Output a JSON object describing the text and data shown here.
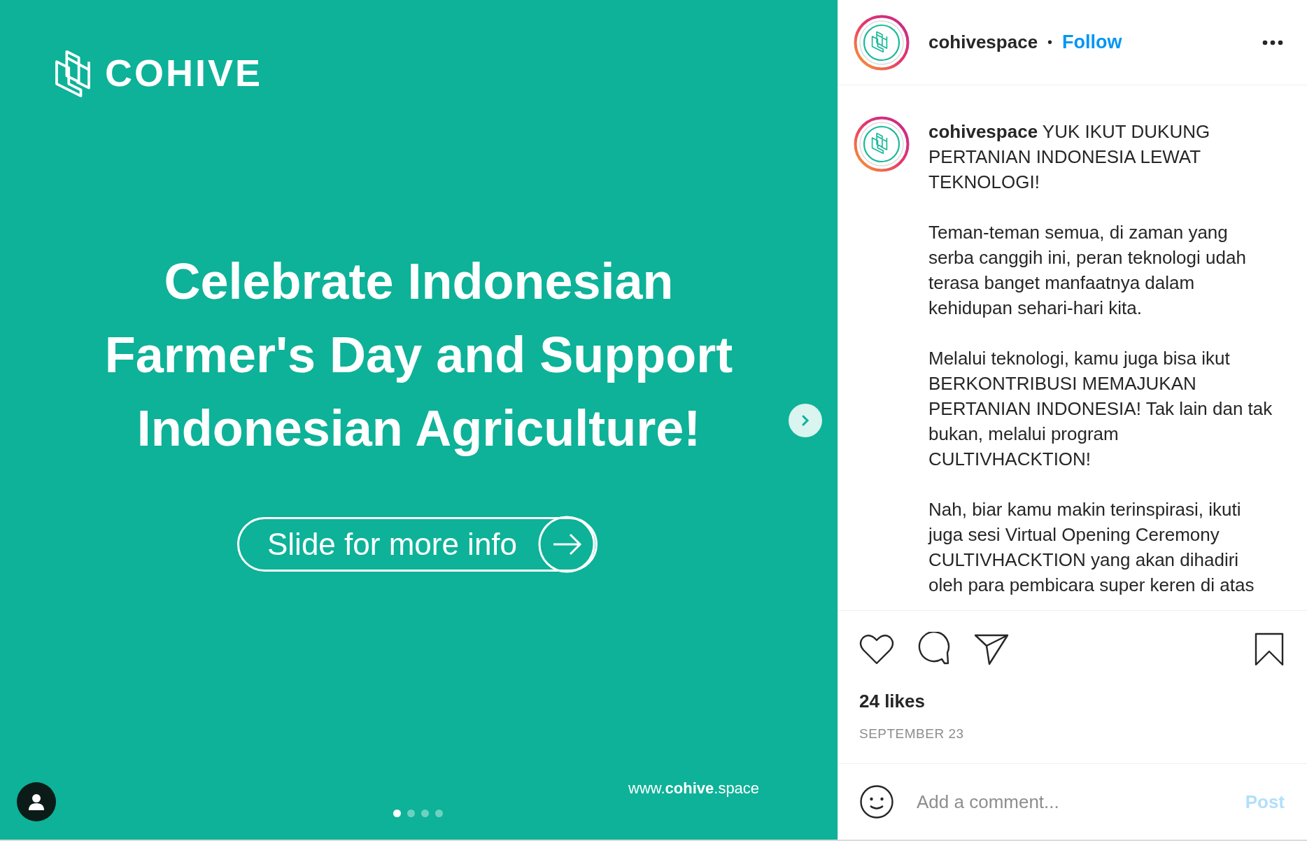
{
  "slide": {
    "brand": "COHIVE",
    "headline": "Celebrate Indonesian\nFarmer's Day and Support\nIndonesian Agriculture!",
    "cta": "Slide for more info",
    "website": "www.**cohive**.space",
    "dots": [
      {
        "selected": true
      },
      {
        "selected": false
      },
      {
        "selected": false
      },
      {
        "selected": false
      }
    ]
  },
  "header": {
    "username": "cohivespace",
    "separator": "•",
    "follow": "Follow"
  },
  "caption": {
    "username": "cohivespace",
    "paragraphs": [
      "YUK IKUT DUKUNG\nPERTANIAN INDONESIA LEWAT\nTEKNOLOGI!",
      "Teman-teman semua, di zaman yang\nserba canggih ini, peran teknologi udah\nterasa banget manfaatnya dalam\nkehidupan sehari-hari kita.",
      "Melalui teknologi, kamu juga bisa ikut\nBERKONTRIBUSI MEMAJUKAN\nPERTANIAN INDONESIA! Tak lain dan tak\nbukan, melalui program\nCULTIVHACKTION!",
      "Nah, biar kamu makin terinspirasi, ikuti\njuga sesi Virtual Opening Ceremony\nCULTIVHACKTION yang akan dihadiri\noleh para pembicara super keren di atas"
    ]
  },
  "likes": "24 likes",
  "date": "SEPTEMBER 23",
  "comment": {
    "placeholder": "Add a comment...",
    "post": "Post",
    "post_disabled": true
  }
}
